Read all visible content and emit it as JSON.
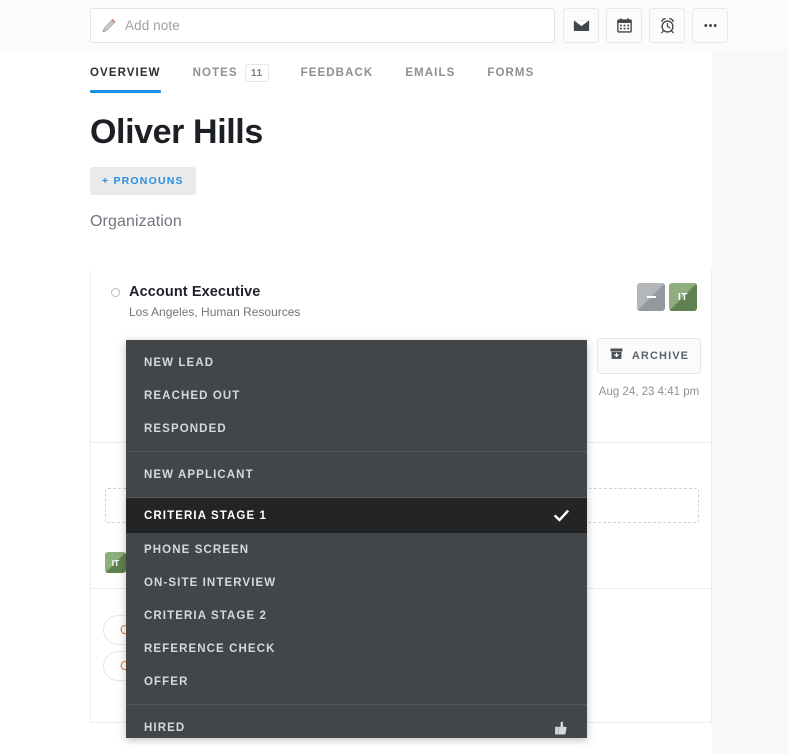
{
  "topbar": {
    "note_placeholder": "Add note",
    "pencil_icon": "pencil-icon",
    "actions": [
      {
        "name": "email-icon",
        "label": "Email"
      },
      {
        "name": "calendar-icon",
        "label": "Calendar"
      },
      {
        "name": "reminder-icon",
        "label": "Reminder"
      },
      {
        "name": "more-icon",
        "label": "More"
      }
    ]
  },
  "tabs": [
    {
      "label": "OVERVIEW",
      "active": true,
      "badge": ""
    },
    {
      "label": "NOTES",
      "active": false,
      "badge": "11"
    },
    {
      "label": "FEEDBACK",
      "active": false,
      "badge": ""
    },
    {
      "label": "EMAILS",
      "active": false,
      "badge": ""
    },
    {
      "label": "FORMS",
      "active": false,
      "badge": ""
    }
  ],
  "profile": {
    "name": "Oliver Hills",
    "pronouns_label": "+ PRONOUNS",
    "organization": "Organization"
  },
  "job": {
    "title": "Account Executive",
    "subtitle": "Los Angeles, Human Resources",
    "archive_label": "ARCHIVE",
    "timestamp": "Aug 24, 23 4:41 pm",
    "avatars": [
      {
        "name": "owner-avatar-empty",
        "initials": "",
        "color": "#9a9fa2"
      },
      {
        "name": "owner-avatar-it",
        "initials": "IT",
        "color": "#6d8c5c"
      }
    ],
    "tags": [
      {
        "label": "Cri",
        "color": "#e0803a"
      },
      {
        "label": "Cri",
        "color": "#e0803a"
      }
    ],
    "source_badge": "IT"
  },
  "stage_menu": {
    "selected": "CRITERIA STAGE 1",
    "groups": [
      {
        "items": [
          {
            "label": "NEW LEAD",
            "selected": false,
            "icon": ""
          },
          {
            "label": "REACHED OUT",
            "selected": false,
            "icon": ""
          },
          {
            "label": "RESPONDED",
            "selected": false,
            "icon": ""
          }
        ]
      },
      {
        "items": [
          {
            "label": "NEW APPLICANT",
            "selected": false,
            "icon": ""
          }
        ]
      },
      {
        "items": [
          {
            "label": "CRITERIA STAGE 1",
            "selected": true,
            "icon": "check-icon"
          },
          {
            "label": "PHONE SCREEN",
            "selected": false,
            "icon": ""
          },
          {
            "label": "ON-SITE INTERVIEW",
            "selected": false,
            "icon": ""
          },
          {
            "label": "CRITERIA STAGE 2",
            "selected": false,
            "icon": ""
          },
          {
            "label": "REFERENCE CHECK",
            "selected": false,
            "icon": ""
          },
          {
            "label": "OFFER",
            "selected": false,
            "icon": ""
          }
        ]
      },
      {
        "items": [
          {
            "label": "HIRED",
            "selected": false,
            "icon": "thumbs-up-icon"
          }
        ]
      }
    ]
  },
  "colors": {
    "accent_blue": "#1a8fe3",
    "menu_bg": "#434648",
    "menu_selected_bg": "#222426",
    "tag_orange": "#e0803a",
    "avatar_green": "#6d8c5c",
    "page_bg": "#f8f8f8"
  }
}
